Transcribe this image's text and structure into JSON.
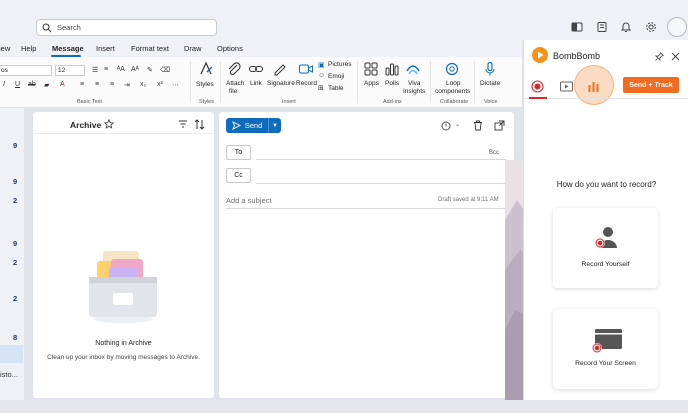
{
  "search": {
    "placeholder": "Search"
  },
  "menu": {
    "items": [
      {
        "label": "iew"
      },
      {
        "label": "Help"
      },
      {
        "label": "Message"
      },
      {
        "label": "Insert"
      },
      {
        "label": "Format text"
      },
      {
        "label": "Draw"
      },
      {
        "label": "Options"
      }
    ]
  },
  "ribbon": {
    "font_name": "os",
    "font_size": "12",
    "groups": {
      "basic_text": "Basic Text",
      "styles": "Styles",
      "insert": "Insert",
      "addins": "Add-ins",
      "collaborate": "Collaborate",
      "voice": "Voice"
    },
    "buttons": {
      "styles": "Styles",
      "attach": "Attach",
      "attach2": "file",
      "link": "Link",
      "signature": "Signature",
      "record": "Record",
      "pictures": "Pictures",
      "emoji": "Emoji",
      "table": "Table",
      "apps": "Apps",
      "polls": "Polls",
      "viva": "Viva",
      "viva2": "Insights",
      "loop": "Loop",
      "loop2": "components",
      "dictate": "Dictate"
    }
  },
  "nav_numbers": [
    "9",
    "9",
    "2",
    "9",
    "2",
    "2",
    "8"
  ],
  "nav_text": "isto...",
  "folder": {
    "title": "Archive",
    "empty_title": "Nothing in Archive",
    "empty_sub": "Clean up your inbox by moving messages to Archive."
  },
  "compose": {
    "send": "Send",
    "to": "To",
    "cc": "Cc",
    "bcc": "Bcc",
    "subject_placeholder": "Add a subject",
    "draft_status": "Draft saved at 9:11 AM"
  },
  "bombbomb": {
    "title": "BombBomb",
    "send_track": "Send + Track",
    "question": "How do you want to record?",
    "card_self": "Record Yourself",
    "card_screen": "Record Your Screen"
  },
  "colors": {
    "accent": "#0f6cbd",
    "brand": "#f6921e",
    "send_track": "#f26b21",
    "record_red": "#d9262a"
  }
}
